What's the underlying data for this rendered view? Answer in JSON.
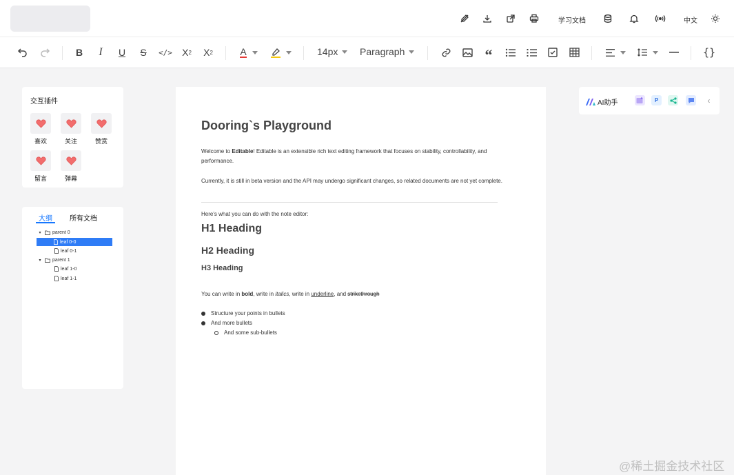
{
  "header": {
    "study_docs": "学习文档",
    "language": "中文",
    "icons": [
      "edit-icon",
      "download-icon",
      "external-link-icon",
      "print-icon",
      "database-icon",
      "bell-icon",
      "broadcast-icon",
      "sun-icon"
    ]
  },
  "toolbar": {
    "bold": "B",
    "italic": "I",
    "underline": "U",
    "strike": "S",
    "code": "</>",
    "subscript": "X",
    "subscript_mark": "2",
    "superscript": "X",
    "superscript_mark": "2",
    "font_color": "A",
    "font_size": "14px",
    "block_type": "Paragraph",
    "quote": "“",
    "code_block": "{}",
    "font_color_hex": "#e53935",
    "highlight_hex": "#f6c90e"
  },
  "plugins": {
    "title": "交互插件",
    "items": [
      {
        "label": "喜欢"
      },
      {
        "label": "关注"
      },
      {
        "label": "赞赏"
      },
      {
        "label": "留言"
      },
      {
        "label": "弹幕"
      }
    ]
  },
  "outline": {
    "tabs": [
      "大纲",
      "所有文档"
    ],
    "active_tab": "大纲",
    "tree": [
      {
        "label": "parent 0"
      },
      {
        "label": "leaf 0-0",
        "selected": true
      },
      {
        "label": "leaf 0-1"
      },
      {
        "label": "parent 1"
      },
      {
        "label": "leaf 1-0"
      },
      {
        "label": "leaf 1-1"
      }
    ]
  },
  "editor": {
    "title": "Dooring`s Playground",
    "p1_a": "Welcome to ",
    "p1_bold": "Editable",
    "p1_b": "! Editable is an extensible rich text editing framework that focuses on stability, controllability, and performance.",
    "p2": "Currently, it is still in beta version and the API may undergo significant changes, so related documents are not yet complete.",
    "p3": "Here's what you can do with the note editor:",
    "h1": "H1 Heading",
    "h2": "H2 Heading",
    "h3": "H3 Heading",
    "fmt_a": "You can write in ",
    "fmt_bold": "bold",
    "fmt_b": ", write in ",
    "fmt_italics": "italics",
    "fmt_c": ", write in ",
    "fmt_underline": "underline",
    "fmt_d": ", and ",
    "fmt_strike": "strikethrough",
    "bullets": [
      "Structure your points in bullets",
      "And more bullets"
    ],
    "sub_bullet": "And some sub-bullets"
  },
  "ai": {
    "label": "AI助手",
    "icons": [
      "image-gen-icon",
      "p-icon",
      "share-icon",
      "chat-icon",
      "chevron-left-icon"
    ]
  },
  "watermark": "@稀土掘金技术社区"
}
